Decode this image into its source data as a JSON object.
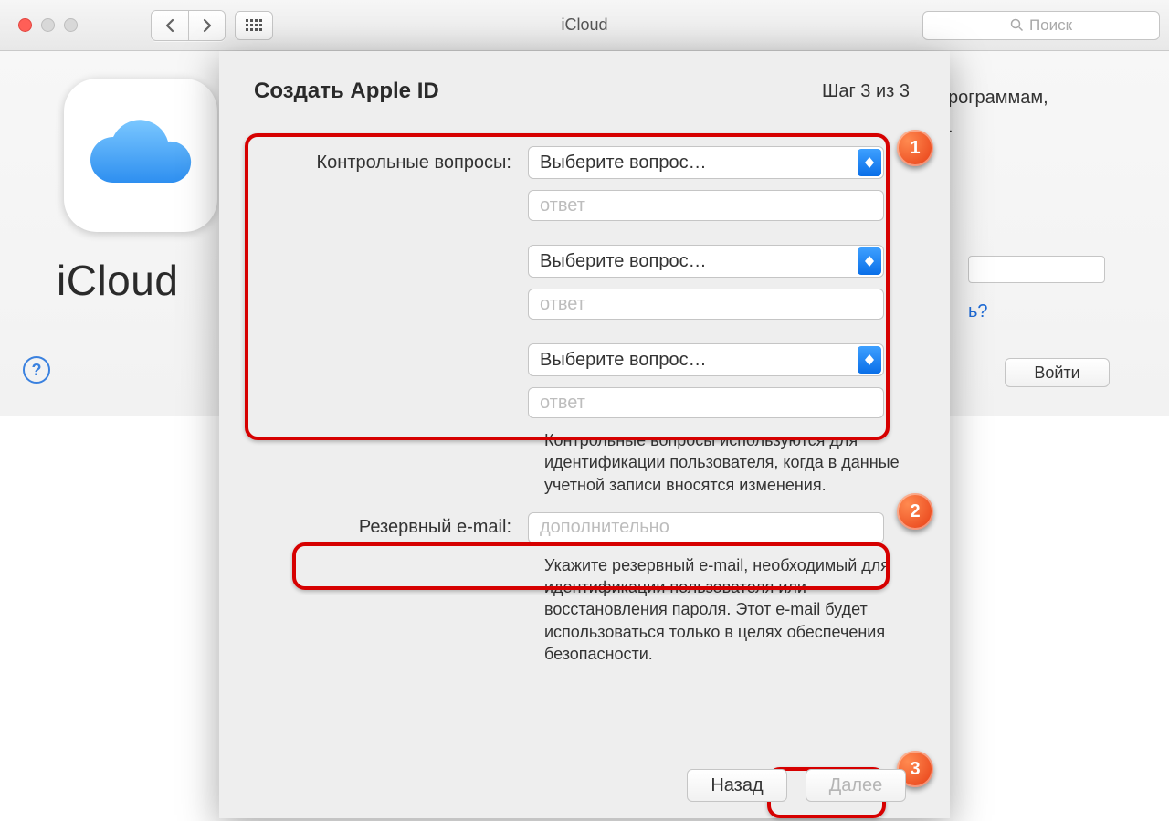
{
  "window": {
    "title": "iCloud",
    "search_placeholder": "Поиск"
  },
  "background": {
    "app_label": "iCloud",
    "text_partial": "рограммам,",
    "link_partial": "ь?",
    "login_button": "Войти",
    "help": "?"
  },
  "sheet": {
    "title": "Создать Apple ID",
    "step": "Шаг 3 из 3",
    "questions_label": "Контрольные вопросы:",
    "select_placeholder": "Выберите вопрос…",
    "answer_placeholder": "ответ",
    "questions_help": "Контрольные вопросы используются для идентификации пользователя, когда в данные учетной записи вносятся изменения.",
    "backup_email_label": "Резервный e-mail:",
    "backup_email_placeholder": "дополнительно",
    "backup_email_help": "Укажите резервный e-mail, необходимый для идентификации пользователя или восстановления пароля. Этот e-mail будет использоваться только в целях обеспечения безопасности.",
    "back_button": "Назад",
    "next_button": "Далее"
  },
  "badges": {
    "b1": "1",
    "b2": "2",
    "b3": "3"
  }
}
